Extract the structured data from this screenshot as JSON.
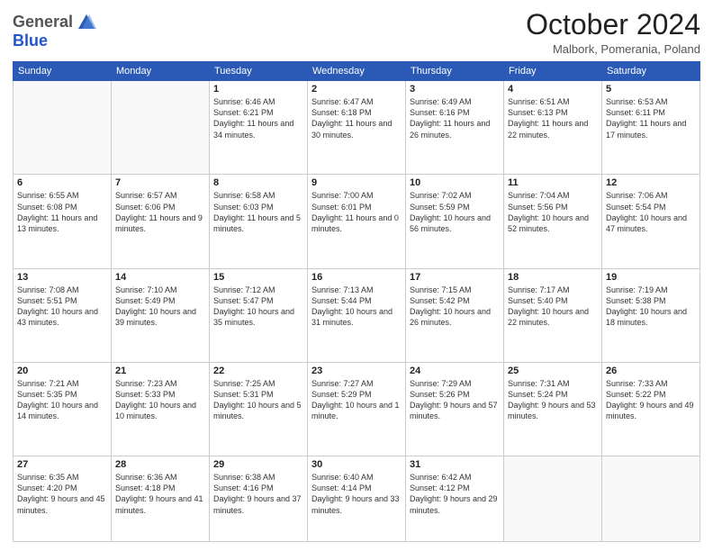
{
  "header": {
    "logo_general": "General",
    "logo_blue": "Blue",
    "month_title": "October 2024",
    "subtitle": "Malbork, Pomerania, Poland"
  },
  "days_of_week": [
    "Sunday",
    "Monday",
    "Tuesday",
    "Wednesday",
    "Thursday",
    "Friday",
    "Saturday"
  ],
  "weeks": [
    [
      {
        "day": "",
        "info": ""
      },
      {
        "day": "",
        "info": ""
      },
      {
        "day": "1",
        "info": "Sunrise: 6:46 AM\nSunset: 6:21 PM\nDaylight: 11 hours and 34 minutes."
      },
      {
        "day": "2",
        "info": "Sunrise: 6:47 AM\nSunset: 6:18 PM\nDaylight: 11 hours and 30 minutes."
      },
      {
        "day": "3",
        "info": "Sunrise: 6:49 AM\nSunset: 6:16 PM\nDaylight: 11 hours and 26 minutes."
      },
      {
        "day": "4",
        "info": "Sunrise: 6:51 AM\nSunset: 6:13 PM\nDaylight: 11 hours and 22 minutes."
      },
      {
        "day": "5",
        "info": "Sunrise: 6:53 AM\nSunset: 6:11 PM\nDaylight: 11 hours and 17 minutes."
      }
    ],
    [
      {
        "day": "6",
        "info": "Sunrise: 6:55 AM\nSunset: 6:08 PM\nDaylight: 11 hours and 13 minutes."
      },
      {
        "day": "7",
        "info": "Sunrise: 6:57 AM\nSunset: 6:06 PM\nDaylight: 11 hours and 9 minutes."
      },
      {
        "day": "8",
        "info": "Sunrise: 6:58 AM\nSunset: 6:03 PM\nDaylight: 11 hours and 5 minutes."
      },
      {
        "day": "9",
        "info": "Sunrise: 7:00 AM\nSunset: 6:01 PM\nDaylight: 11 hours and 0 minutes."
      },
      {
        "day": "10",
        "info": "Sunrise: 7:02 AM\nSunset: 5:59 PM\nDaylight: 10 hours and 56 minutes."
      },
      {
        "day": "11",
        "info": "Sunrise: 7:04 AM\nSunset: 5:56 PM\nDaylight: 10 hours and 52 minutes."
      },
      {
        "day": "12",
        "info": "Sunrise: 7:06 AM\nSunset: 5:54 PM\nDaylight: 10 hours and 47 minutes."
      }
    ],
    [
      {
        "day": "13",
        "info": "Sunrise: 7:08 AM\nSunset: 5:51 PM\nDaylight: 10 hours and 43 minutes."
      },
      {
        "day": "14",
        "info": "Sunrise: 7:10 AM\nSunset: 5:49 PM\nDaylight: 10 hours and 39 minutes."
      },
      {
        "day": "15",
        "info": "Sunrise: 7:12 AM\nSunset: 5:47 PM\nDaylight: 10 hours and 35 minutes."
      },
      {
        "day": "16",
        "info": "Sunrise: 7:13 AM\nSunset: 5:44 PM\nDaylight: 10 hours and 31 minutes."
      },
      {
        "day": "17",
        "info": "Sunrise: 7:15 AM\nSunset: 5:42 PM\nDaylight: 10 hours and 26 minutes."
      },
      {
        "day": "18",
        "info": "Sunrise: 7:17 AM\nSunset: 5:40 PM\nDaylight: 10 hours and 22 minutes."
      },
      {
        "day": "19",
        "info": "Sunrise: 7:19 AM\nSunset: 5:38 PM\nDaylight: 10 hours and 18 minutes."
      }
    ],
    [
      {
        "day": "20",
        "info": "Sunrise: 7:21 AM\nSunset: 5:35 PM\nDaylight: 10 hours and 14 minutes."
      },
      {
        "day": "21",
        "info": "Sunrise: 7:23 AM\nSunset: 5:33 PM\nDaylight: 10 hours and 10 minutes."
      },
      {
        "day": "22",
        "info": "Sunrise: 7:25 AM\nSunset: 5:31 PM\nDaylight: 10 hours and 5 minutes."
      },
      {
        "day": "23",
        "info": "Sunrise: 7:27 AM\nSunset: 5:29 PM\nDaylight: 10 hours and 1 minute."
      },
      {
        "day": "24",
        "info": "Sunrise: 7:29 AM\nSunset: 5:26 PM\nDaylight: 9 hours and 57 minutes."
      },
      {
        "day": "25",
        "info": "Sunrise: 7:31 AM\nSunset: 5:24 PM\nDaylight: 9 hours and 53 minutes."
      },
      {
        "day": "26",
        "info": "Sunrise: 7:33 AM\nSunset: 5:22 PM\nDaylight: 9 hours and 49 minutes."
      }
    ],
    [
      {
        "day": "27",
        "info": "Sunrise: 6:35 AM\nSunset: 4:20 PM\nDaylight: 9 hours and 45 minutes."
      },
      {
        "day": "28",
        "info": "Sunrise: 6:36 AM\nSunset: 4:18 PM\nDaylight: 9 hours and 41 minutes."
      },
      {
        "day": "29",
        "info": "Sunrise: 6:38 AM\nSunset: 4:16 PM\nDaylight: 9 hours and 37 minutes."
      },
      {
        "day": "30",
        "info": "Sunrise: 6:40 AM\nSunset: 4:14 PM\nDaylight: 9 hours and 33 minutes."
      },
      {
        "day": "31",
        "info": "Sunrise: 6:42 AM\nSunset: 4:12 PM\nDaylight: 9 hours and 29 minutes."
      },
      {
        "day": "",
        "info": ""
      },
      {
        "day": "",
        "info": ""
      }
    ]
  ]
}
